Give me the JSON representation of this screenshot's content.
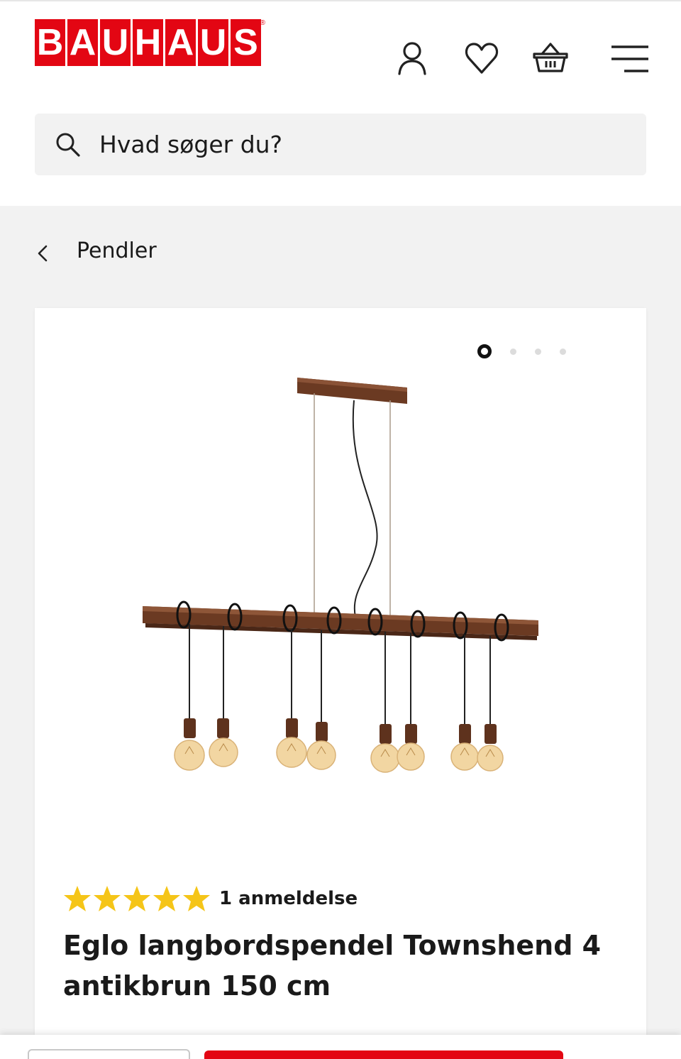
{
  "header": {
    "logo_text": "BAUHAUS",
    "logo_letters": [
      "B",
      "A",
      "U",
      "H",
      "A",
      "U",
      "S"
    ],
    "logo_registered": "®",
    "icons": [
      "user-icon",
      "heart-icon",
      "basket-icon",
      "menu-icon"
    ]
  },
  "search": {
    "placeholder": "Hvad søger du?"
  },
  "breadcrumb": {
    "label": "Pendler"
  },
  "product": {
    "image_count": 4,
    "active_image": 1,
    "rating": 5,
    "reviews_label": "1 anmeldelse",
    "title": "Eglo langbordspendel Townshend 4 antikbrun 150 cm"
  },
  "colors": {
    "brand": "#e30613",
    "star": "#f5c518",
    "wood": "#6b3a22"
  }
}
